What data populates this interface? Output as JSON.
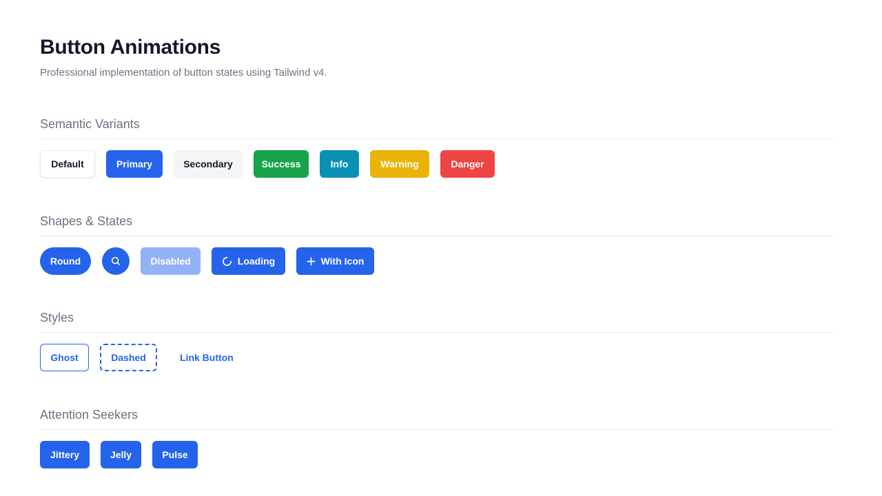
{
  "header": {
    "title": "Button Animations",
    "subtitle": "Professional implementation of button states using Tailwind v4."
  },
  "sections": [
    {
      "title": "Semantic Variants",
      "buttons": [
        "Default",
        "Primary",
        "Secondary",
        "Success",
        "Info",
        "Warning",
        "Danger"
      ]
    },
    {
      "title": "Shapes & States",
      "buttons": {
        "round": "Round",
        "search_icon": "search-icon",
        "disabled": "Disabled",
        "loading": "Loading",
        "with_icon": "With Icon"
      }
    },
    {
      "title": "Styles",
      "buttons": [
        "Ghost",
        "Dashed",
        "Link Button"
      ]
    },
    {
      "title": "Attention Seekers",
      "buttons": [
        "Jittery",
        "Jelly",
        "Pulse"
      ]
    }
  ],
  "colors": {
    "primary": "#2563eb",
    "success": "#16a34a",
    "info": "#0891b2",
    "warning": "#eab308",
    "danger": "#ef4444",
    "disabled": "#93b2f5",
    "secondary": "#f3f4f6"
  }
}
